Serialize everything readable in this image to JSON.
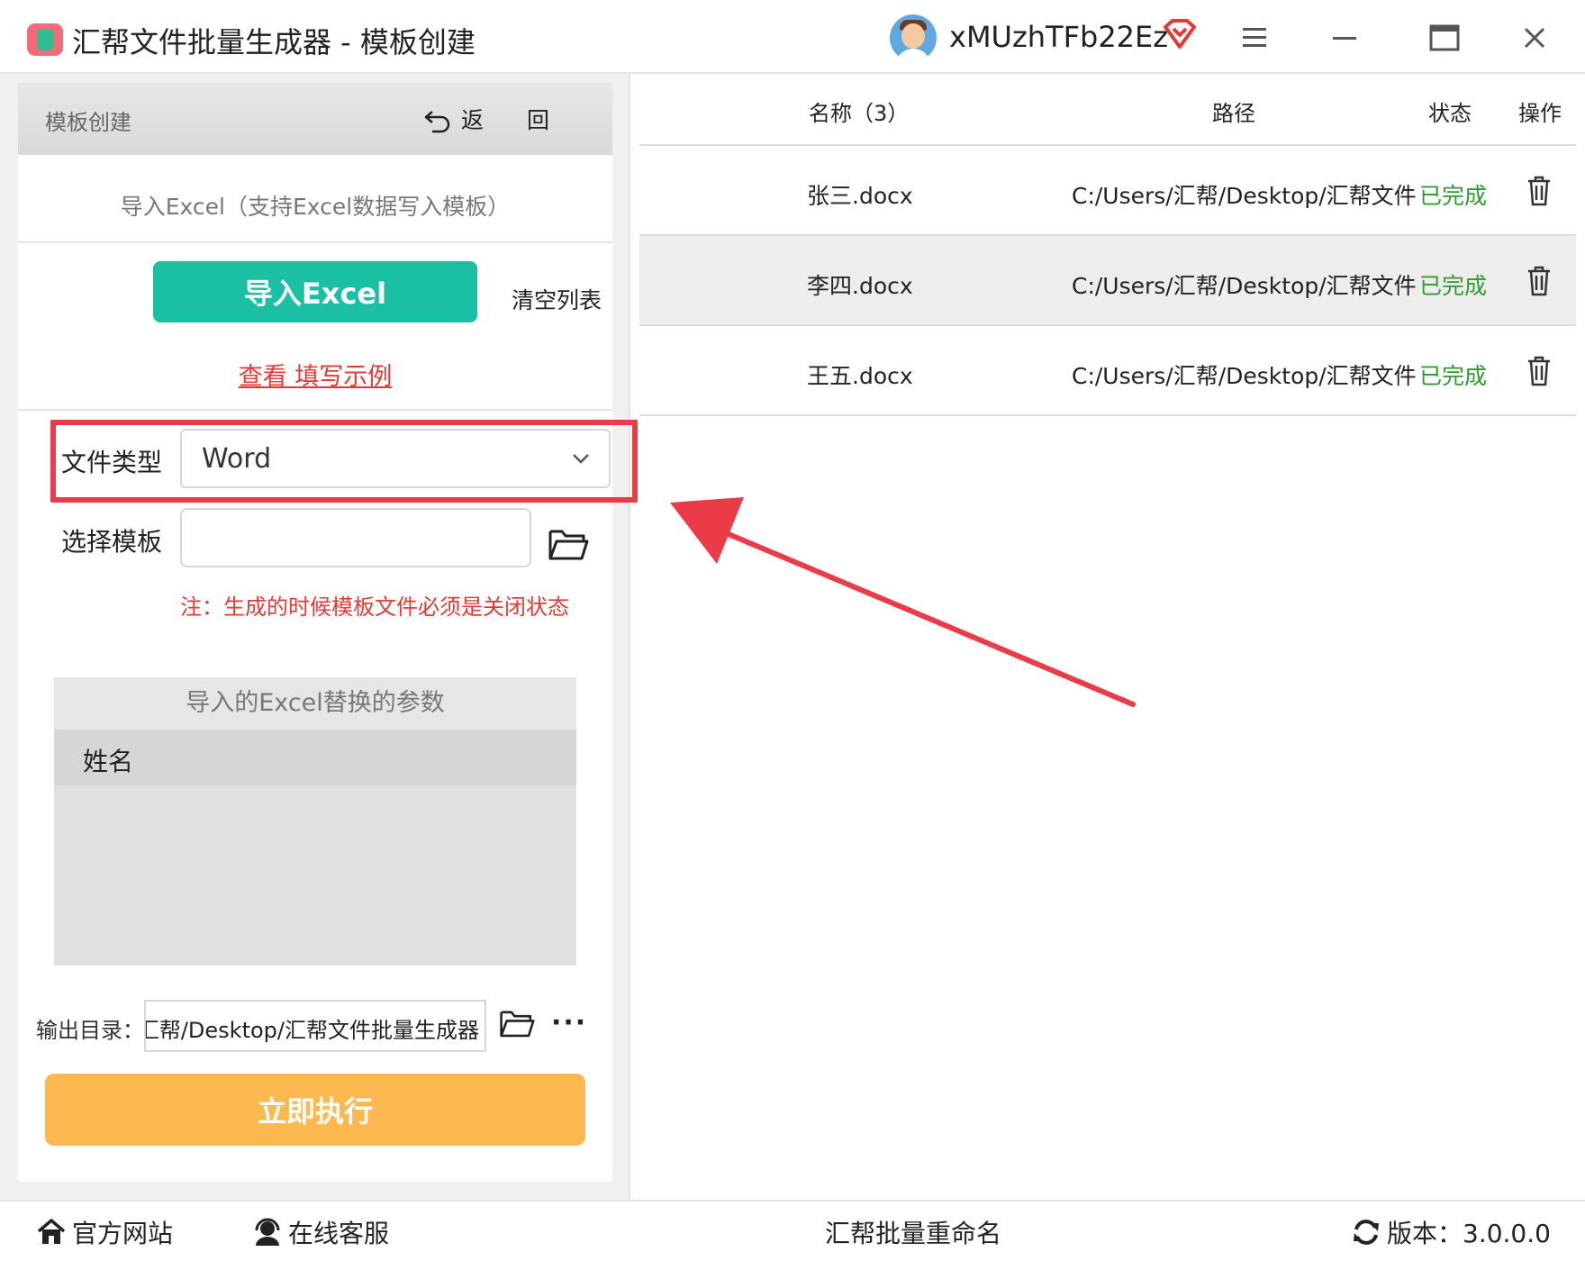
{
  "app": {
    "title": "汇帮文件批量生成器 - 模板创建",
    "username": "xMUzhTFb22Ez",
    "icons": {
      "app": "app-logo-icon",
      "vip": "vip-diamond-icon",
      "menu": "menu-icon",
      "minimize": "minimize-icon",
      "maximize": "maximize-icon",
      "close": "close-icon"
    }
  },
  "left": {
    "header_title": "模板创建",
    "back_label": "返 回",
    "import_hint": "导入Excel（支持Excel数据写入模板）",
    "import_button": "导入Excel",
    "clear_list": "清空列表",
    "example_link": "查看 填写示例",
    "file_type_label": "文件类型",
    "file_type_value": "Word",
    "template_label": "选择模板",
    "template_value": "",
    "note": "注：生成的时候模板文件必须是关闭状态",
    "params_header": "导入的Excel替换的参数",
    "params": [
      "姓名"
    ],
    "output_label": "输出目录：",
    "output_value": "汇帮/Desktop/汇帮文件批量生成器",
    "more_label": "···",
    "run_button": "立即执行"
  },
  "table": {
    "headers": {
      "name": "名称（3）",
      "path": "路径",
      "status": "状态",
      "action": "操作"
    },
    "rows": [
      {
        "name": "张三.docx",
        "path": "C:/Users/汇帮/Desktop/汇帮文件",
        "status": "已完成"
      },
      {
        "name": "李四.docx",
        "path": "C:/Users/汇帮/Desktop/汇帮文件",
        "status": "已完成"
      },
      {
        "name": "王五.docx",
        "path": "C:/Users/汇帮/Desktop/汇帮文件",
        "status": "已完成"
      }
    ]
  },
  "footer": {
    "website": "官方网站",
    "support": "在线客服",
    "center": "汇帮批量重命名",
    "version": "版本：3.0.0.0"
  },
  "colors": {
    "accent_green": "#1bbfa4",
    "run_orange": "#fdb94f",
    "highlight_red": "#ea3b48",
    "status_green": "#2e9c2e",
    "link_red": "#e53935"
  }
}
